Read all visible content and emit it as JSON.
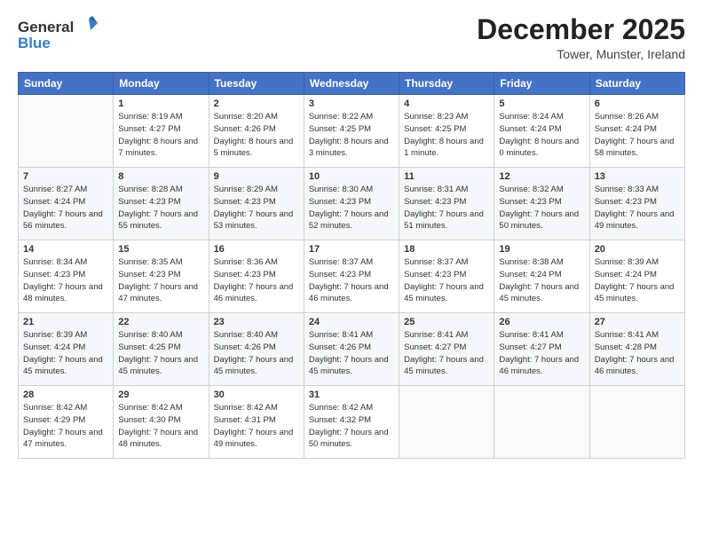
{
  "header": {
    "logo_general": "General",
    "logo_blue": "Blue",
    "month_title": "December 2025",
    "location": "Tower, Munster, Ireland"
  },
  "days_of_week": [
    "Sunday",
    "Monday",
    "Tuesday",
    "Wednesday",
    "Thursday",
    "Friday",
    "Saturday"
  ],
  "weeks": [
    [
      {
        "day": "",
        "empty": true
      },
      {
        "day": "1",
        "sunrise": "8:19 AM",
        "sunset": "4:27 PM",
        "daylight": "8 hours and 7 minutes."
      },
      {
        "day": "2",
        "sunrise": "8:20 AM",
        "sunset": "4:26 PM",
        "daylight": "8 hours and 5 minutes."
      },
      {
        "day": "3",
        "sunrise": "8:22 AM",
        "sunset": "4:25 PM",
        "daylight": "8 hours and 3 minutes."
      },
      {
        "day": "4",
        "sunrise": "8:23 AM",
        "sunset": "4:25 PM",
        "daylight": "8 hours and 1 minute."
      },
      {
        "day": "5",
        "sunrise": "8:24 AM",
        "sunset": "4:24 PM",
        "daylight": "8 hours and 0 minutes."
      },
      {
        "day": "6",
        "sunrise": "8:26 AM",
        "sunset": "4:24 PM",
        "daylight": "7 hours and 58 minutes."
      }
    ],
    [
      {
        "day": "7",
        "sunrise": "8:27 AM",
        "sunset": "4:24 PM",
        "daylight": "7 hours and 56 minutes."
      },
      {
        "day": "8",
        "sunrise": "8:28 AM",
        "sunset": "4:23 PM",
        "daylight": "7 hours and 55 minutes."
      },
      {
        "day": "9",
        "sunrise": "8:29 AM",
        "sunset": "4:23 PM",
        "daylight": "7 hours and 53 minutes."
      },
      {
        "day": "10",
        "sunrise": "8:30 AM",
        "sunset": "4:23 PM",
        "daylight": "7 hours and 52 minutes."
      },
      {
        "day": "11",
        "sunrise": "8:31 AM",
        "sunset": "4:23 PM",
        "daylight": "7 hours and 51 minutes."
      },
      {
        "day": "12",
        "sunrise": "8:32 AM",
        "sunset": "4:23 PM",
        "daylight": "7 hours and 50 minutes."
      },
      {
        "day": "13",
        "sunrise": "8:33 AM",
        "sunset": "4:23 PM",
        "daylight": "7 hours and 49 minutes."
      }
    ],
    [
      {
        "day": "14",
        "sunrise": "8:34 AM",
        "sunset": "4:23 PM",
        "daylight": "7 hours and 48 minutes."
      },
      {
        "day": "15",
        "sunrise": "8:35 AM",
        "sunset": "4:23 PM",
        "daylight": "7 hours and 47 minutes."
      },
      {
        "day": "16",
        "sunrise": "8:36 AM",
        "sunset": "4:23 PM",
        "daylight": "7 hours and 46 minutes."
      },
      {
        "day": "17",
        "sunrise": "8:37 AM",
        "sunset": "4:23 PM",
        "daylight": "7 hours and 46 minutes."
      },
      {
        "day": "18",
        "sunrise": "8:37 AM",
        "sunset": "4:23 PM",
        "daylight": "7 hours and 45 minutes."
      },
      {
        "day": "19",
        "sunrise": "8:38 AM",
        "sunset": "4:24 PM",
        "daylight": "7 hours and 45 minutes."
      },
      {
        "day": "20",
        "sunrise": "8:39 AM",
        "sunset": "4:24 PM",
        "daylight": "7 hours and 45 minutes."
      }
    ],
    [
      {
        "day": "21",
        "sunrise": "8:39 AM",
        "sunset": "4:24 PM",
        "daylight": "7 hours and 45 minutes."
      },
      {
        "day": "22",
        "sunrise": "8:40 AM",
        "sunset": "4:25 PM",
        "daylight": "7 hours and 45 minutes."
      },
      {
        "day": "23",
        "sunrise": "8:40 AM",
        "sunset": "4:26 PM",
        "daylight": "7 hours and 45 minutes."
      },
      {
        "day": "24",
        "sunrise": "8:41 AM",
        "sunset": "4:26 PM",
        "daylight": "7 hours and 45 minutes."
      },
      {
        "day": "25",
        "sunrise": "8:41 AM",
        "sunset": "4:27 PM",
        "daylight": "7 hours and 45 minutes."
      },
      {
        "day": "26",
        "sunrise": "8:41 AM",
        "sunset": "4:27 PM",
        "daylight": "7 hours and 46 minutes."
      },
      {
        "day": "27",
        "sunrise": "8:41 AM",
        "sunset": "4:28 PM",
        "daylight": "7 hours and 46 minutes."
      }
    ],
    [
      {
        "day": "28",
        "sunrise": "8:42 AM",
        "sunset": "4:29 PM",
        "daylight": "7 hours and 47 minutes."
      },
      {
        "day": "29",
        "sunrise": "8:42 AM",
        "sunset": "4:30 PM",
        "daylight": "7 hours and 48 minutes."
      },
      {
        "day": "30",
        "sunrise": "8:42 AM",
        "sunset": "4:31 PM",
        "daylight": "7 hours and 49 minutes."
      },
      {
        "day": "31",
        "sunrise": "8:42 AM",
        "sunset": "4:32 PM",
        "daylight": "7 hours and 50 minutes."
      },
      {
        "day": "",
        "empty": true
      },
      {
        "day": "",
        "empty": true
      },
      {
        "day": "",
        "empty": true
      }
    ]
  ],
  "labels": {
    "sunrise": "Sunrise:",
    "sunset": "Sunset:",
    "daylight": "Daylight:"
  }
}
